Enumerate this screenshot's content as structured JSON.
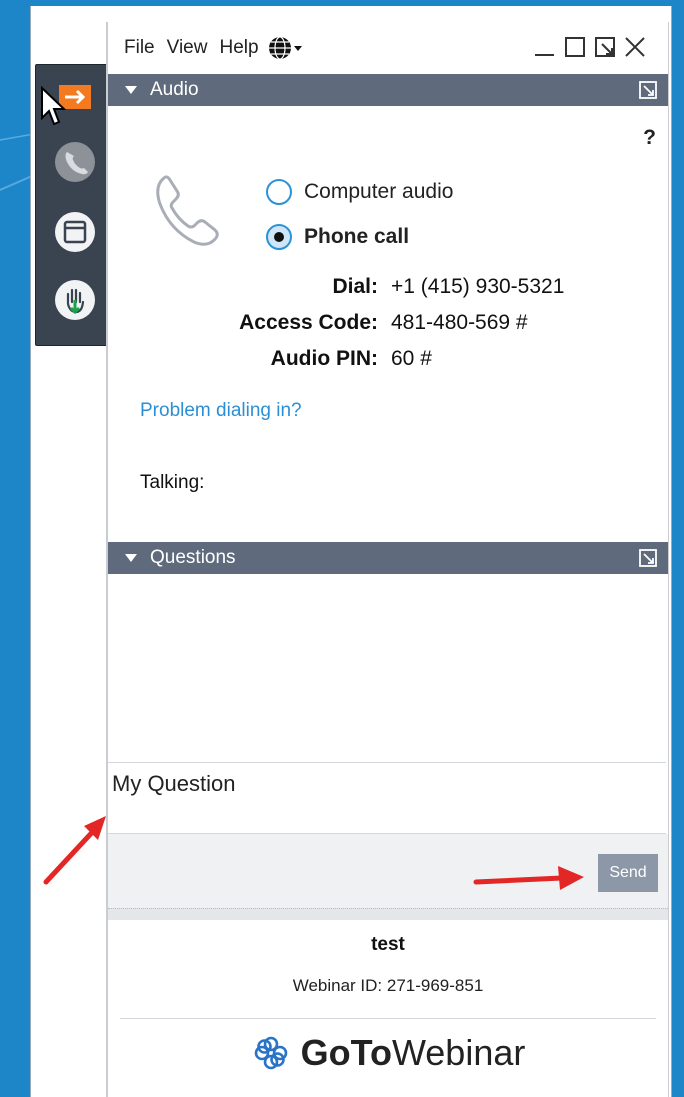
{
  "menu": {
    "file": "File",
    "view": "View",
    "help": "Help"
  },
  "audio": {
    "header": "Audio",
    "help_label": "?",
    "option_computer": "Computer audio",
    "option_phone": "Phone call",
    "selected": "Phone call",
    "dial_label": "Dial:",
    "dial_value": "+1 (415) 930-5321",
    "access_code_label": "Access Code:",
    "access_code_value": "481-480-569 #",
    "pin_label": "Audio PIN:",
    "pin_value": "60 #",
    "problem_link": "Problem dialing in?",
    "talking_label": "Talking:"
  },
  "questions": {
    "header": "Questions",
    "input_text": "My Question",
    "send_label": "Send"
  },
  "footer": {
    "title": "test",
    "webinar_id": "Webinar ID: 271-969-851",
    "brand_goto": "GoTo",
    "brand_webinar": "Webinar"
  },
  "colors": {
    "section_header": "#5f6b7c",
    "link": "#2b8fd6",
    "radio_accent": "#2b92d8",
    "arrow": "#e32626",
    "side_panel": "#3a4350",
    "brand_icon": "#2a73c6"
  },
  "icons": {
    "side_1": "orange-arrow-icon",
    "side_2": "phone-icon",
    "side_3": "window-icon",
    "side_4": "raise-hand-icon",
    "language": "globe-icon"
  }
}
